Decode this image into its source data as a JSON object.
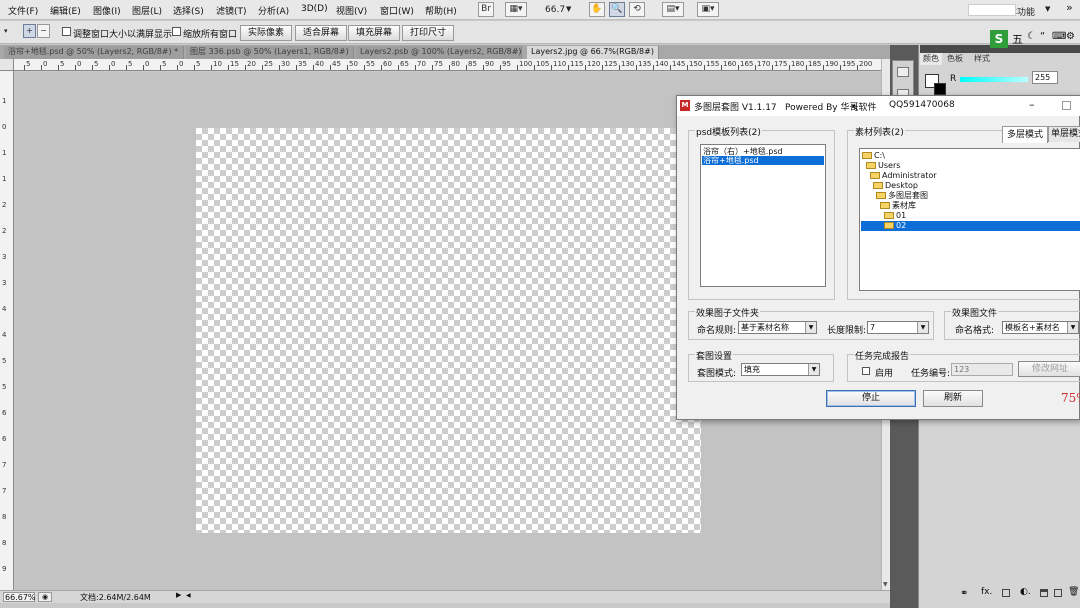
{
  "menu": [
    "文件(F)",
    "编辑(E)",
    "图像(I)",
    "图层(L)",
    "选择(S)",
    "滤镜(T)",
    "分析(A)",
    "3D(D)",
    "视图(V)",
    "窗口(W)",
    "帮助(H)"
  ],
  "toolbar": {
    "zoom_value": "66.7",
    "workspace_label": "基本功能"
  },
  "options": {
    "resize_label": "调整窗口大小以满屏显示",
    "zoom_all_label": "缩放所有窗口",
    "buttons": [
      "实际像素",
      "适合屏幕",
      "填充屏幕",
      "打印尺寸"
    ]
  },
  "doc_tabs": [
    "浴帘+地毯.psd @ 50% (Layers2, RGB/8#) *",
    "图层 336.psb @ 50% (Layers1, RGB/8#)",
    "Layers2.psb @ 100% (Layers2, RGB/8#) *",
    "Layers2.jpg @ 66.7%(RGB/8#)"
  ],
  "ruler": {
    "h": [
      "5",
      "0",
      "5",
      "0",
      "5",
      "0",
      "5",
      "0",
      "5",
      "0",
      "5",
      "10",
      "15",
      "20",
      "25",
      "30",
      "35",
      "40",
      "45",
      "50",
      "55",
      "60",
      "65",
      "70",
      "75",
      "80",
      "85",
      "90",
      "95",
      "100",
      "105",
      "110",
      "115",
      "120",
      "125",
      "130",
      "135",
      "140",
      "145",
      "150",
      "155",
      "160",
      "165",
      "170",
      "175",
      "180",
      "185",
      "190",
      "195",
      "200",
      "205"
    ],
    "v": [
      "1",
      "0",
      "1",
      "1",
      "2",
      "2",
      "3",
      "3",
      "4",
      "4",
      "5",
      "5",
      "6",
      "6",
      "7",
      "7",
      "8",
      "8",
      "9",
      "9"
    ]
  },
  "status": {
    "zoom": "66.67%",
    "doc_info": "文档:2.64M/2.64M"
  },
  "right_panel": {
    "tabs": [
      "颜色",
      "色板",
      "样式"
    ],
    "r_label": "R",
    "r_value": "255",
    "ime_label": "五"
  },
  "dialog": {
    "title": "多图层套图 V1.1.17",
    "powered": "Powered By 华哥软件",
    "qq": "QQ591470068",
    "psd_group": "psd模板列表(2)",
    "psd_items": [
      "浴帘（右）+地毯.psd",
      "浴帘+地毯.psd"
    ],
    "material_group": "素材列表(2)",
    "mode_tabs": [
      "多层模式",
      "单层模式"
    ],
    "tree": [
      "C:\\",
      "Users",
      "Administrator",
      "Desktop",
      "多图层套图",
      "素材库",
      "01",
      "02"
    ],
    "effect_folder_group": "效果图子文件夹",
    "naming_rule_label": "命名规则:",
    "naming_rule_value": "基于素材名称",
    "length_label": "长度限制:",
    "length_value": "7",
    "effect_file_group": "效果图文件",
    "naming_format_label": "命名格式:",
    "naming_format_value": "模板名+素材名",
    "set_group": "套图设置",
    "set_mode_label": "套图模式:",
    "set_mode_value": "填充",
    "report_group": "任务完成报告",
    "enable_label": "启用",
    "task_no_label": "任务编号:",
    "task_no_placeholder": "123",
    "modify_url_label": "修改网址",
    "stop_label": "停止",
    "refresh_label": "刷新",
    "progress": "75%"
  },
  "colors": {
    "selection": "#0c6ed6",
    "progress": "#d32f2f",
    "dock": "#5a5a5a"
  }
}
